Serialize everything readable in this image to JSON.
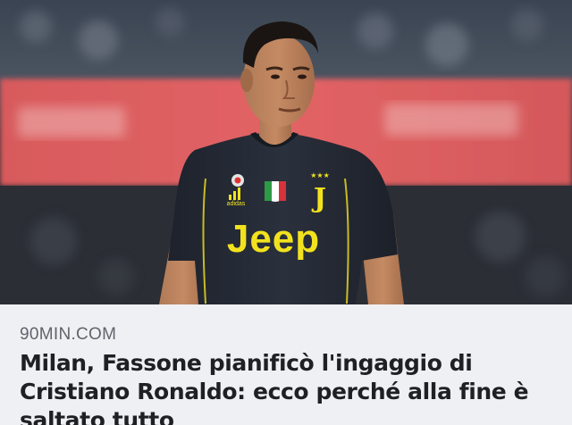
{
  "article": {
    "image_alt": "Cristiano Ronaldo in Juventus jersey",
    "jersey": {
      "sponsor": "Jeep",
      "maker": "adidas",
      "crest_letter": "J",
      "crest_stars": "★★★"
    },
    "source": "90MIN.COM",
    "headline": "Milan, Fassone pianificò l'ingaggio di Cristiano Ronaldo: ecco perché alla fine è saltato tutto"
  },
  "colors": {
    "jersey": "#232833",
    "sponsor": "#f2e21e",
    "caption_bg": "#eef0f3",
    "headline": "#1e2024",
    "source": "#60646b"
  }
}
